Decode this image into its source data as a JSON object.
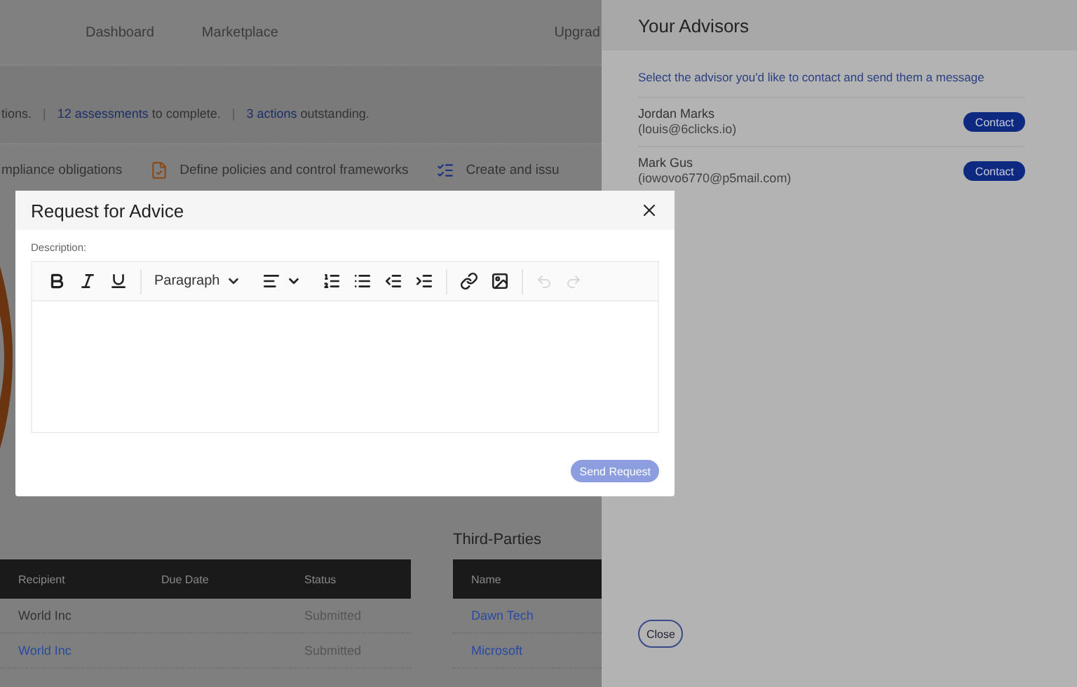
{
  "nav": {
    "links": [
      "Dashboard",
      "Marketplace",
      "Upgrad"
    ]
  },
  "summary": [
    {
      "text": "tions."
    },
    {
      "separator": "|",
      "link": "12 assessments",
      "text": " to complete."
    },
    {
      "separator": "|",
      "link": "3 actions",
      "text": " outstanding."
    }
  ],
  "tasks": [
    {
      "kind": "plain",
      "label": "mpliance obligations"
    },
    {
      "kind": "document",
      "label": "Define policies and control frameworks"
    },
    {
      "kind": "list",
      "label": "Create and issu"
    }
  ],
  "assessments_table": {
    "columns": [
      "Recipient",
      "Due Date",
      "Status"
    ],
    "rows": [
      {
        "recipient": "World Inc",
        "kind": "text",
        "status": "Submitted"
      },
      {
        "recipient": "World Inc",
        "kind": "link",
        "status": "Submitted"
      }
    ]
  },
  "third_parties": {
    "title": "Third-Parties",
    "columns": [
      "Name"
    ],
    "rows": [
      "Dawn Tech",
      "Microsoft"
    ]
  },
  "advisors_panel": {
    "title": "Your Advisors",
    "instruction": "Select the advisor you'd like to contact and send them a message",
    "advisors": [
      {
        "name": "Jordan Marks",
        "email": "(louis@6clicks.io)",
        "button": "Contact"
      },
      {
        "name": "Mark Gus",
        "email": "(iowovo6770@p5mail.com)",
        "button": "Contact"
      }
    ],
    "close_button": "Close"
  },
  "modal": {
    "title": "Request for Advice",
    "description_label": "Description:",
    "toolbar": {
      "block_format": "Paragraph",
      "history": [
        {
          "kind": "undo",
          "disabled": true
        },
        {
          "kind": "redo",
          "disabled": true
        }
      ]
    },
    "send_button": {
      "label": "Send Request",
      "disabled": true
    }
  }
}
